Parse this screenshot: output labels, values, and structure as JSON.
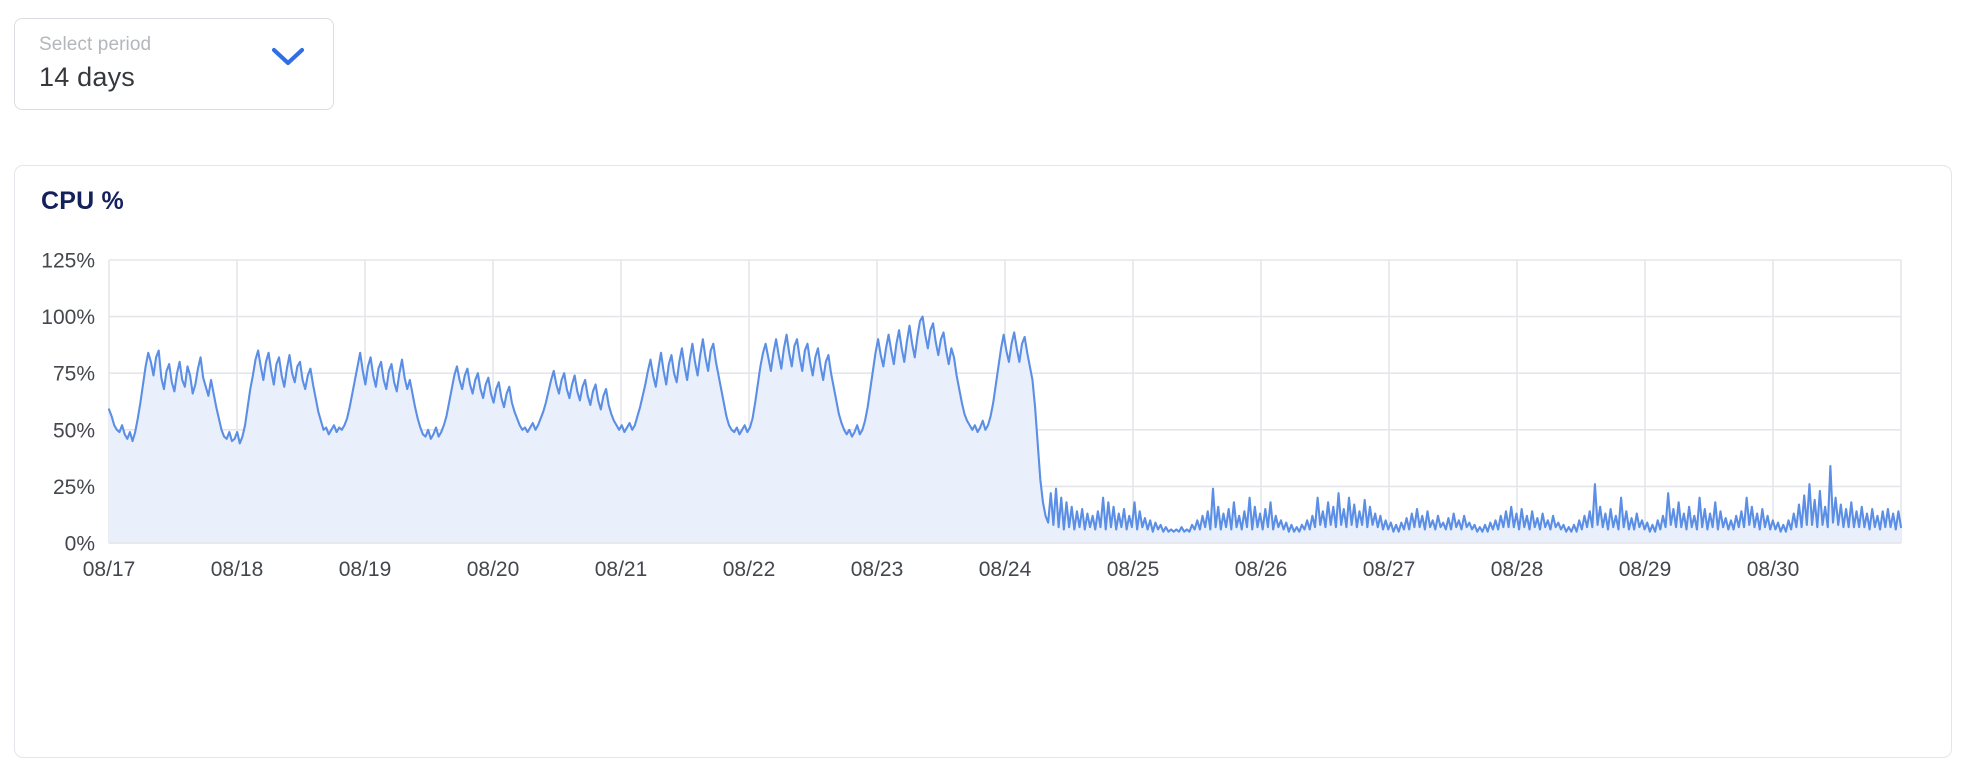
{
  "period_select": {
    "label": "Select period",
    "value": "14 days",
    "chevron_icon": "chevron-down-icon",
    "chevron_color": "#2f6fe4"
  },
  "card": {
    "title": "CPU %"
  },
  "colors": {
    "line": "#5b8ee5",
    "area": "#eaf0fb",
    "grid": "#e4e6e9",
    "axis_text": "#44474d",
    "title": "#14215b",
    "accent": "#2f6fe4",
    "card_border": "#e3e6ea"
  },
  "chart_data": {
    "type": "area",
    "title": "CPU %",
    "xlabel": "",
    "ylabel": "CPU %",
    "ylim": [
      0,
      125
    ],
    "yticks": [
      0,
      25,
      50,
      75,
      100,
      125
    ],
    "ytick_labels": [
      "0%",
      "25%",
      "50%",
      "75%",
      "100%",
      "125%"
    ],
    "grid": true,
    "legend": "none",
    "x_tick_labels": [
      "08/17",
      "08/18",
      "08/19",
      "08/20",
      "08/21",
      "08/22",
      "08/23",
      "08/24",
      "08/25",
      "08/26",
      "08/27",
      "08/28",
      "08/29",
      "08/30"
    ],
    "x_range_days": 14,
    "samples_per_day": 48,
    "annotations": [
      "Daily business-hours cycles peaking 75-100% through 08/24",
      "Sharp drop to low-utilisation regime (5-25%) shortly after 08/24",
      "Maximum approx. 100% near 08/23-08/24"
    ],
    "values": [
      59,
      56,
      52,
      50,
      49,
      52,
      48,
      46,
      49,
      45,
      49,
      55,
      62,
      70,
      78,
      84,
      80,
      74,
      82,
      85,
      73,
      68,
      76,
      79,
      71,
      67,
      75,
      80,
      72,
      69,
      78,
      74,
      66,
      70,
      77,
      82,
      73,
      69,
      65,
      72,
      66,
      60,
      55,
      50,
      47,
      46,
      49,
      45,
      46,
      49,
      44,
      47,
      52,
      60,
      68,
      74,
      81,
      85,
      78,
      72,
      80,
      84,
      76,
      70,
      79,
      82,
      74,
      69,
      77,
      83,
      75,
      71,
      78,
      80,
      72,
      68,
      74,
      77,
      70,
      64,
      58,
      54,
      50,
      51,
      48,
      50,
      52,
      49,
      51,
      50,
      52,
      55,
      60,
      66,
      72,
      78,
      84,
      76,
      70,
      78,
      82,
      74,
      69,
      77,
      80,
      72,
      68,
      76,
      79,
      71,
      67,
      75,
      81,
      73,
      68,
      72,
      66,
      60,
      55,
      51,
      48,
      47,
      50,
      46,
      48,
      51,
      47,
      49,
      52,
      56,
      62,
      68,
      74,
      78,
      72,
      68,
      74,
      77,
      70,
      66,
      72,
      75,
      68,
      64,
      70,
      73,
      66,
      62,
      68,
      71,
      64,
      60,
      66,
      69,
      62,
      58,
      55,
      52,
      50,
      51,
      49,
      51,
      53,
      50,
      52,
      55,
      58,
      62,
      67,
      72,
      76,
      70,
      66,
      72,
      75,
      68,
      64,
      70,
      74,
      67,
      63,
      69,
      72,
      65,
      61,
      67,
      70,
      63,
      59,
      65,
      68,
      61,
      57,
      54,
      52,
      50,
      52,
      49,
      51,
      53,
      50,
      52,
      56,
      60,
      65,
      70,
      76,
      81,
      74,
      69,
      77,
      84,
      76,
      70,
      79,
      83,
      75,
      71,
      80,
      86,
      78,
      72,
      81,
      88,
      80,
      74,
      83,
      90,
      82,
      76,
      85,
      88,
      80,
      74,
      68,
      62,
      56,
      52,
      50,
      49,
      51,
      48,
      50,
      52,
      49,
      51,
      55,
      62,
      70,
      78,
      84,
      88,
      82,
      76,
      84,
      90,
      83,
      77,
      86,
      92,
      84,
      78,
      87,
      90,
      82,
      76,
      85,
      88,
      80,
      74,
      82,
      86,
      78,
      72,
      80,
      83,
      75,
      69,
      63,
      57,
      53,
      50,
      48,
      50,
      47,
      49,
      52,
      48,
      50,
      54,
      60,
      68,
      76,
      84,
      90,
      83,
      78,
      86,
      92,
      85,
      79,
      88,
      94,
      86,
      80,
      89,
      96,
      88,
      82,
      91,
      98,
      100,
      92,
      86,
      94,
      97,
      89,
      83,
      90,
      93,
      85,
      79,
      86,
      82,
      74,
      68,
      62,
      57,
      54,
      52,
      50,
      52,
      49,
      51,
      54,
      50,
      52,
      56,
      62,
      70,
      78,
      86,
      92,
      85,
      80,
      88,
      93,
      86,
      80,
      88,
      91,
      84,
      78,
      72,
      60,
      44,
      28,
      18,
      12,
      9,
      22,
      8,
      24,
      7,
      20,
      6,
      18,
      7,
      16,
      6,
      14,
      7,
      15,
      6,
      13,
      7,
      12,
      6,
      14,
      7,
      20,
      6,
      18,
      7,
      16,
      6,
      13,
      7,
      15,
      6,
      12,
      7,
      18,
      6,
      14,
      7,
      11,
      6,
      10,
      5,
      9,
      6,
      8,
      5,
      7,
      5,
      6,
      5,
      6,
      5,
      7,
      5,
      6,
      5,
      8,
      6,
      10,
      6,
      12,
      7,
      14,
      6,
      24,
      7,
      16,
      6,
      13,
      7,
      15,
      6,
      18,
      7,
      12,
      6,
      14,
      7,
      20,
      6,
      16,
      7,
      13,
      6,
      15,
      7,
      18,
      6,
      12,
      7,
      10,
      6,
      9,
      5,
      8,
      5,
      7,
      5,
      8,
      6,
      10,
      6,
      12,
      7,
      20,
      8,
      14,
      7,
      18,
      8,
      16,
      7,
      22,
      8,
      15,
      7,
      20,
      8,
      17,
      7,
      14,
      8,
      19,
      7,
      16,
      8,
      13,
      7,
      12,
      6,
      10,
      6,
      9,
      5,
      8,
      5,
      9,
      6,
      11,
      6,
      13,
      7,
      15,
      7,
      12,
      6,
      14,
      7,
      10,
      6,
      12,
      7,
      9,
      6,
      11,
      6,
      13,
      7,
      10,
      6,
      12,
      7,
      9,
      6,
      8,
      5,
      7,
      5,
      8,
      5,
      9,
      6,
      10,
      6,
      12,
      7,
      14,
      7,
      16,
      7,
      13,
      6,
      15,
      7,
      12,
      6,
      14,
      7,
      11,
      6,
      13,
      7,
      10,
      6,
      12,
      7,
      9,
      6,
      8,
      5,
      7,
      5,
      8,
      5,
      10,
      6,
      12,
      7,
      14,
      7,
      26,
      8,
      16,
      7,
      13,
      6,
      15,
      7,
      12,
      6,
      20,
      7,
      14,
      6,
      11,
      6,
      13,
      7,
      10,
      6,
      9,
      5,
      8,
      5,
      10,
      6,
      12,
      7,
      22,
      8,
      15,
      7,
      18,
      7,
      13,
      6,
      16,
      7,
      12,
      6,
      20,
      7,
      15,
      6,
      13,
      7,
      18,
      6,
      14,
      7,
      11,
      6,
      10,
      6,
      12,
      7,
      14,
      7,
      20,
      8,
      16,
      7,
      13,
      6,
      15,
      7,
      12,
      6,
      10,
      6,
      9,
      5,
      8,
      5,
      10,
      6,
      13,
      7,
      17,
      7,
      21,
      8,
      26,
      8,
      19,
      7,
      23,
      8,
      16,
      7,
      34,
      9,
      20,
      8,
      17,
      7,
      15,
      7,
      18,
      7,
      14,
      7,
      16,
      7,
      13,
      6,
      15,
      7,
      12,
      6,
      14,
      7,
      15,
      7,
      13,
      6,
      14,
      7
    ]
  }
}
